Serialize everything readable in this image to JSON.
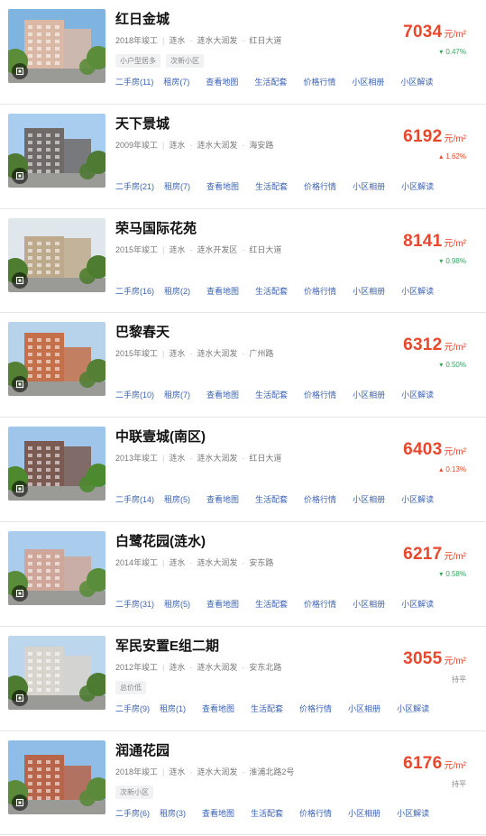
{
  "unit_label": "元/m²",
  "link_labels": {
    "second_hand_prefix": "二手房",
    "rent_prefix": "租房",
    "map": "查看地图",
    "amenities": "生活配套",
    "price_trend": "价格行情",
    "photos": "小区相册",
    "analysis": "小区解读"
  },
  "communities": [
    {
      "name": "红日金城",
      "year": "2018年竣工",
      "district": "涟水",
      "area": "涟水大润发",
      "road": "红日大道",
      "tags": [
        "小户型居多",
        "次新小区"
      ],
      "second_hand": "二手房(11)",
      "rent": "租房(7)",
      "price": "7034",
      "change": "0.47%",
      "trend": "down",
      "trend_symbol": "▾"
    },
    {
      "name": "天下景城",
      "year": "2009年竣工",
      "district": "涟水",
      "area": "涟水大润发",
      "road": "海安路",
      "tags": [],
      "second_hand": "二手房(21)",
      "rent": "租房(7)",
      "price": "6192",
      "change": "1.62%",
      "trend": "up",
      "trend_symbol": "▴"
    },
    {
      "name": "荣马国际花苑",
      "year": "2015年竣工",
      "district": "涟水",
      "area": "涟水开发区",
      "road": "红日大道",
      "tags": [],
      "second_hand": "二手房(16)",
      "rent": "租房(2)",
      "price": "8141",
      "change": "0.98%",
      "trend": "down",
      "trend_symbol": "▾"
    },
    {
      "name": "巴黎春天",
      "year": "2015年竣工",
      "district": "涟水",
      "area": "涟水大润发",
      "road": "广州路",
      "tags": [],
      "second_hand": "二手房(10)",
      "rent": "租房(7)",
      "price": "6312",
      "change": "0.50%",
      "trend": "down",
      "trend_symbol": "▾"
    },
    {
      "name": "中联壹城(南区)",
      "year": "2013年竣工",
      "district": "涟水",
      "area": "涟水大润发",
      "road": "红日大道",
      "tags": [],
      "second_hand": "二手房(14)",
      "rent": "租房(5)",
      "price": "6403",
      "change": "0.13%",
      "trend": "up",
      "trend_symbol": "▴"
    },
    {
      "name": "白鹭花园(涟水)",
      "year": "2014年竣工",
      "district": "涟水",
      "area": "涟水大润发",
      "road": "安东路",
      "tags": [],
      "second_hand": "二手房(31)",
      "rent": "租房(5)",
      "price": "6217",
      "change": "0.58%",
      "trend": "down",
      "trend_symbol": "▾"
    },
    {
      "name": "军民安置E组二期",
      "year": "2012年竣工",
      "district": "涟水",
      "area": "涟水大润发",
      "road": "安东北路",
      "tags": [
        "总价低"
      ],
      "second_hand": "二手房(9)",
      "rent": "租房(1)",
      "price": "3055",
      "change": "持平",
      "trend": "flat",
      "trend_symbol": ""
    },
    {
      "name": "润通花园",
      "year": "2018年竣工",
      "district": "涟水",
      "area": "涟水大润发",
      "road": "淮浦北路2号",
      "tags": [
        "次新小区"
      ],
      "second_hand": "二手房(6)",
      "rent": "租房(3)",
      "price": "6176",
      "change": "持平",
      "trend": "flat",
      "trend_symbol": ""
    }
  ],
  "palette": {
    "price": "#e8472c",
    "trend_up": "#e8472c",
    "trend_down": "#3aa55d",
    "trend_flat": "#888888",
    "link": "#3a62b5"
  },
  "photos": [
    {
      "sky": "#7fb3e0",
      "building": "#d9b8a6",
      "tree": "#5b8c3a"
    },
    {
      "sky": "#a9cdee",
      "building": "#6f6a68",
      "tree": "#4f7a34"
    },
    {
      "sky": "#dfe7ec",
      "building": "#bda98c",
      "tree": "#4e7c30"
    },
    {
      "sky": "#b7d3ec",
      "building": "#c4704a",
      "tree": "#557f35"
    },
    {
      "sky": "#9fc6ea",
      "building": "#7b5a52",
      "tree": "#4d8a2f"
    },
    {
      "sky": "#aacdee",
      "building": "#cfa79a",
      "tree": "#5a8d3b"
    },
    {
      "sky": "#bcd6ee",
      "building": "#d7d4cd",
      "tree": "#4d7b31"
    },
    {
      "sky": "#8fbde8",
      "building": "#b7654a",
      "tree": "#5a8a3a"
    }
  ]
}
